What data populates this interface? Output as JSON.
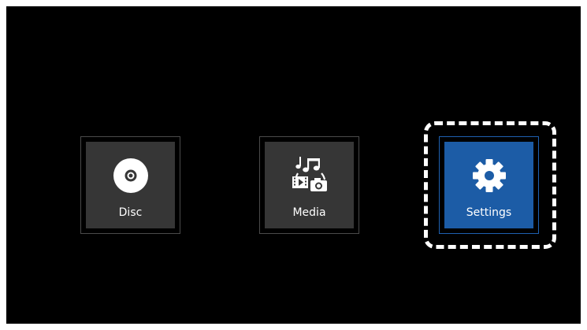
{
  "menu": {
    "items": [
      {
        "label": "Disc",
        "icon": "disc-icon"
      },
      {
        "label": "Media",
        "icon": "media-icon"
      },
      {
        "label": "Settings",
        "icon": "gear-icon",
        "selected": true
      }
    ]
  },
  "colors": {
    "background": "#000000",
    "tile": "#363636",
    "selected_tile": "#1c5ca6",
    "focus_ring": "#ffffff"
  }
}
